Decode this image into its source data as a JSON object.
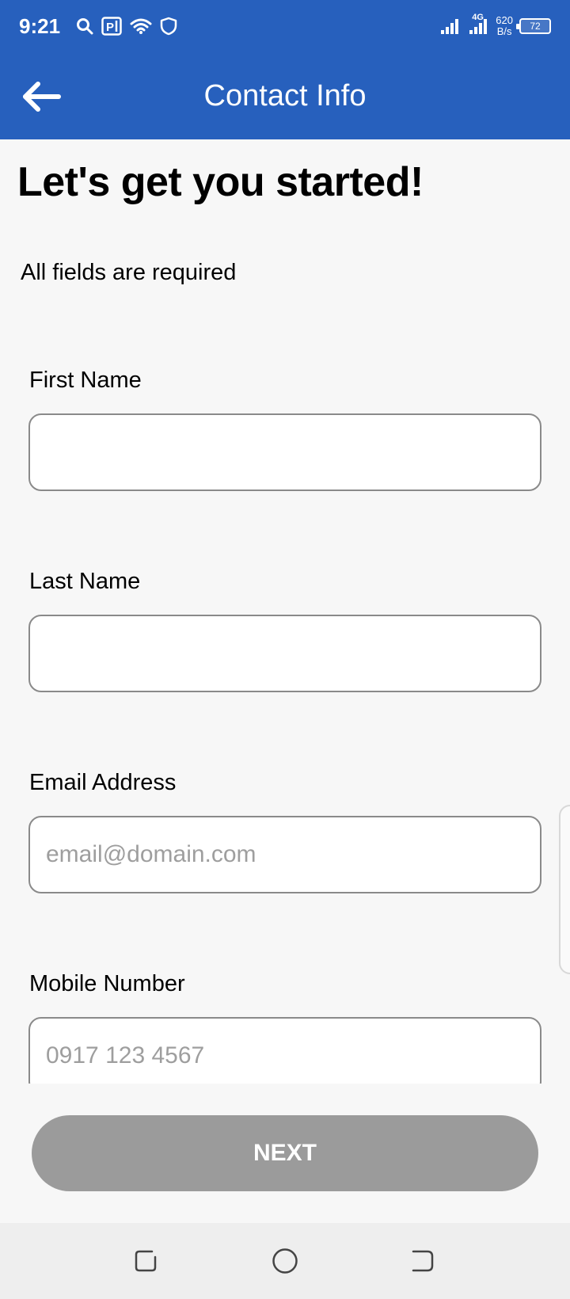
{
  "status_bar": {
    "time": "9:21",
    "network_speed_value": "620",
    "network_speed_unit": "B/s",
    "network_type": "4G",
    "battery": "72",
    "icons": [
      "search-icon",
      "parking-icon",
      "wifi-icon",
      "shield-icon",
      "signal-icon",
      "signal-4g-icon",
      "battery-icon"
    ]
  },
  "app_bar": {
    "title": "Contact Info",
    "back_icon": "arrow-left-icon"
  },
  "main": {
    "heading": "Let's get you started!",
    "required_note": "All fields are required",
    "fields": [
      {
        "label": "First Name",
        "value": "",
        "placeholder": ""
      },
      {
        "label": "Last Name",
        "value": "",
        "placeholder": ""
      },
      {
        "label": "Email Address",
        "value": "",
        "placeholder": "email@domain.com"
      },
      {
        "label": "Mobile Number",
        "value": "",
        "placeholder": "0917 123 4567"
      }
    ],
    "next_label": "NEXT"
  },
  "nav_bar": {
    "icons": [
      "recent-apps-icon",
      "home-icon",
      "back-icon"
    ]
  },
  "colors": {
    "primary": "#2760bd",
    "button_disabled": "#9b9b9b",
    "background": "#f7f7f7"
  }
}
